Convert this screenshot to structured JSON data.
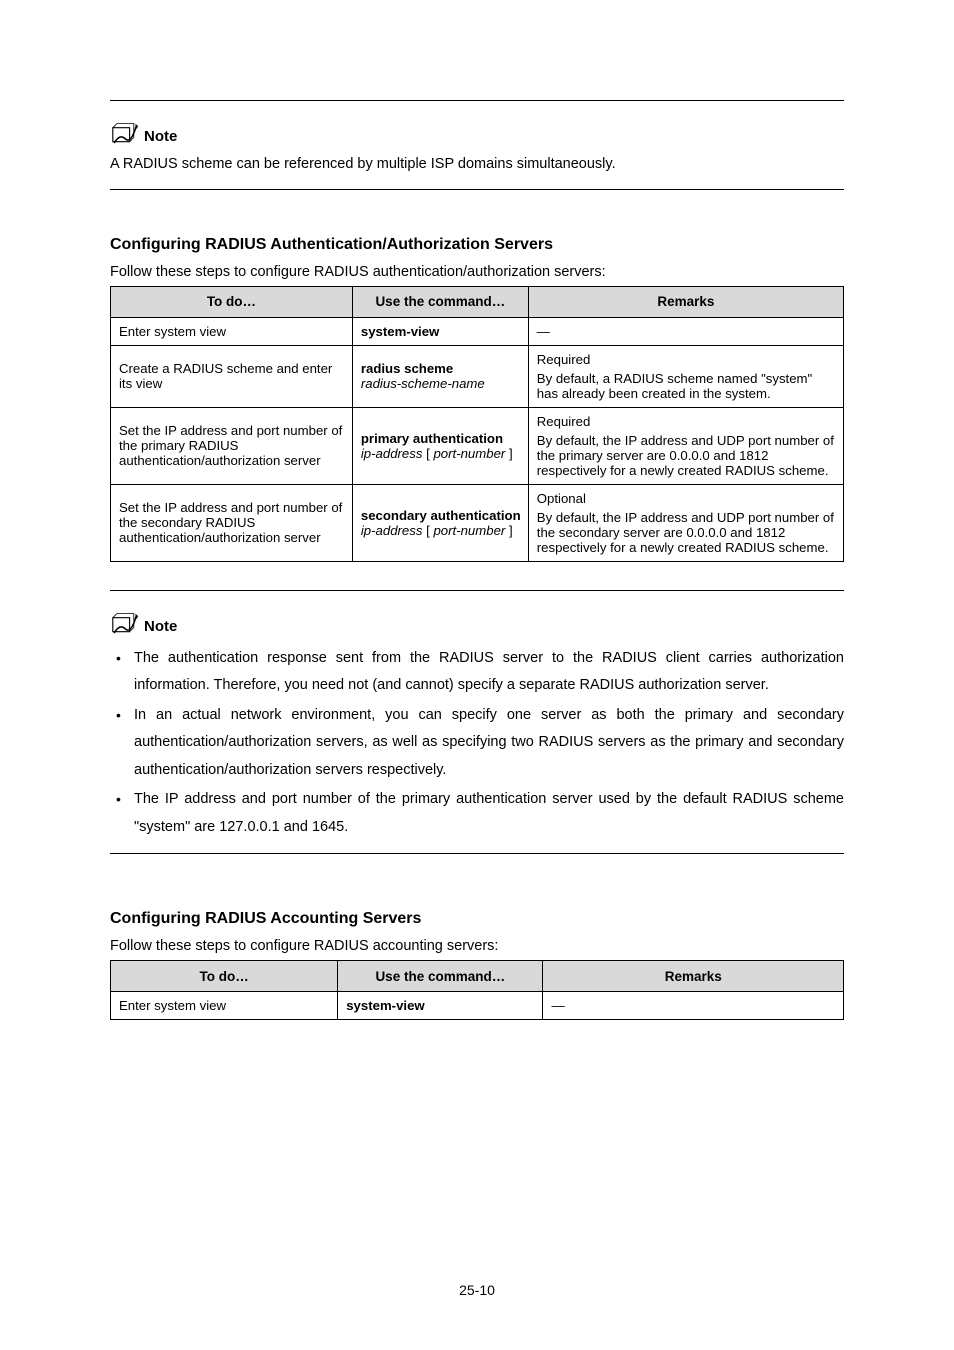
{
  "note1": {
    "label": "Note",
    "text": "A RADIUS scheme can be referenced by multiple ISP domains simultaneously."
  },
  "section1": {
    "title": "Configuring RADIUS Authentication/Authorization Servers",
    "intro": "Follow these steps to configure RADIUS authentication/authorization servers:",
    "headers": {
      "to": "To do…",
      "use": "Use the command…",
      "rem": "Remarks"
    },
    "rows": [
      {
        "to": "Enter system view",
        "cmd_b": "system-view",
        "rem": "—"
      },
      {
        "to": "Create a RADIUS scheme and enter its view",
        "cmd_b1": "radius scheme",
        "cmd_i1": "radius-scheme-name",
        "rem1": "Required",
        "rem2": "By default, a RADIUS scheme named \"system\" has already been created in the system."
      },
      {
        "to": "Set the IP address and port number of the primary RADIUS authentication/authorization server",
        "cmd_b1": "primary authentication",
        "cmd_i1": "ip-address",
        "open": "[",
        "cmd_i2": "port-number",
        "close": "]",
        "rem1": "Required",
        "rem2": "By default, the IP address and UDP port number of the primary server are 0.0.0.0 and 1812 respectively for a newly created RADIUS scheme."
      },
      {
        "to": "Set the IP address and port number of the secondary RADIUS authentication/authorization server",
        "cmd_b1": "secondary authentication",
        "cmd_i1": "ip-address",
        "open": "[",
        "cmd_i2": "port-number",
        "close": "]",
        "rem1": "Optional",
        "rem2": "By default, the IP address and UDP port number of the secondary server are 0.0.0.0 and 1812 respectively for a newly created RADIUS scheme."
      }
    ]
  },
  "note2": {
    "label": "Note",
    "bullets": [
      "The authentication response sent from the RADIUS server to the RADIUS client carries authorization information. Therefore, you need not (and cannot) specify a separate RADIUS authorization server.",
      "In an actual network environment, you can specify one server as both the primary and secondary authentication/authorization servers, as well as specifying two RADIUS servers as the primary and secondary authentication/authorization servers respectively.",
      "The IP address and port number of the primary authentication server used by the default RADIUS scheme \"system\" are 127.0.0.1 and 1645."
    ]
  },
  "section2": {
    "title": "Configuring RADIUS Accounting Servers",
    "intro": "Follow these steps to configure RADIUS accounting servers:",
    "headers": {
      "to": "To do…",
      "use": "Use the command…",
      "rem": "Remarks"
    },
    "rows": [
      {
        "to": "Enter system view",
        "cmd_b": "system-view",
        "rem": "—"
      }
    ]
  },
  "pagenum": "25-10"
}
